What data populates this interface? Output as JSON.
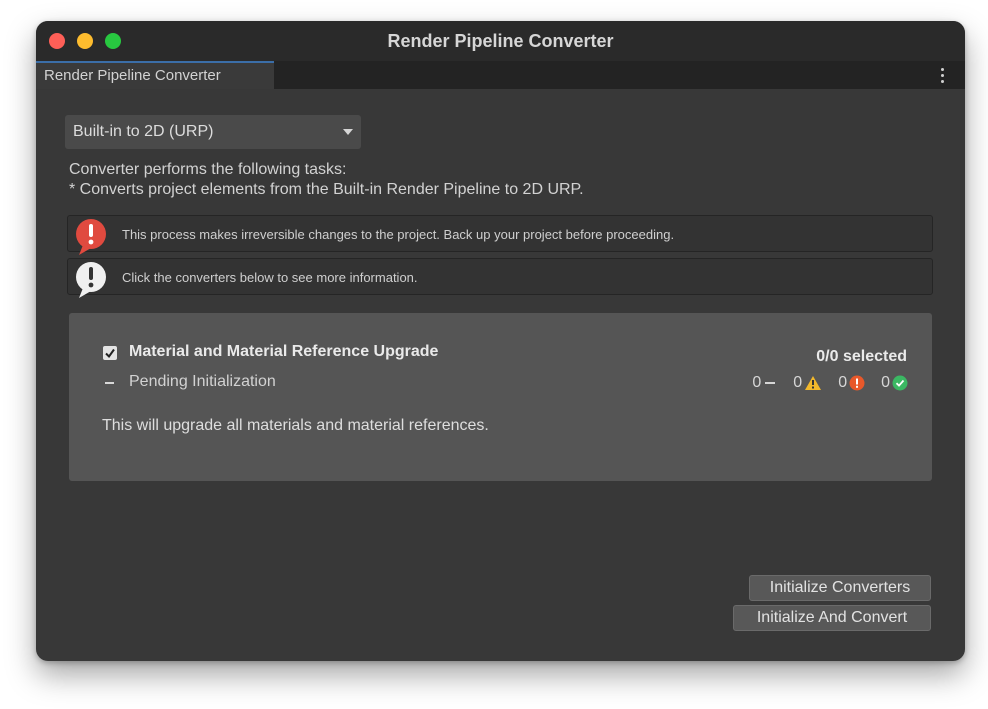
{
  "window": {
    "title": "Render Pipeline Converter"
  },
  "tab": {
    "label": "Render Pipeline Converter"
  },
  "converter_dropdown": {
    "selected": "Built-in to 2D (URP)"
  },
  "description": {
    "line1": "Converter performs the following tasks:",
    "line2": "* Converts project elements from the Built-in Render Pipeline to 2D URP."
  },
  "notices": [
    {
      "icon": "error-icon",
      "text": "This process makes irreversible changes to the project. Back up your project before proceeding.",
      "color": "#e04a3f"
    },
    {
      "icon": "info-icon",
      "text": "Click the converters below to see more information.",
      "color": "#f0f0f0"
    }
  ],
  "converter": {
    "checked": true,
    "title": "Material and Material Reference Upgrade",
    "selected_text": "0/0 selected",
    "status": "Pending Initialization",
    "description": "This will upgrade all materials and material references.",
    "counts": {
      "pending": "0",
      "warnings": "0",
      "errors": "0",
      "success": "0"
    }
  },
  "buttons": {
    "initialize": "Initialize Converters",
    "initialize_and_convert": "Initialize And Convert"
  },
  "colors": {
    "warning": "#f2b82b",
    "error": "#e8582a",
    "success": "#3bb863",
    "tab_accent": "#3b6ea8"
  }
}
